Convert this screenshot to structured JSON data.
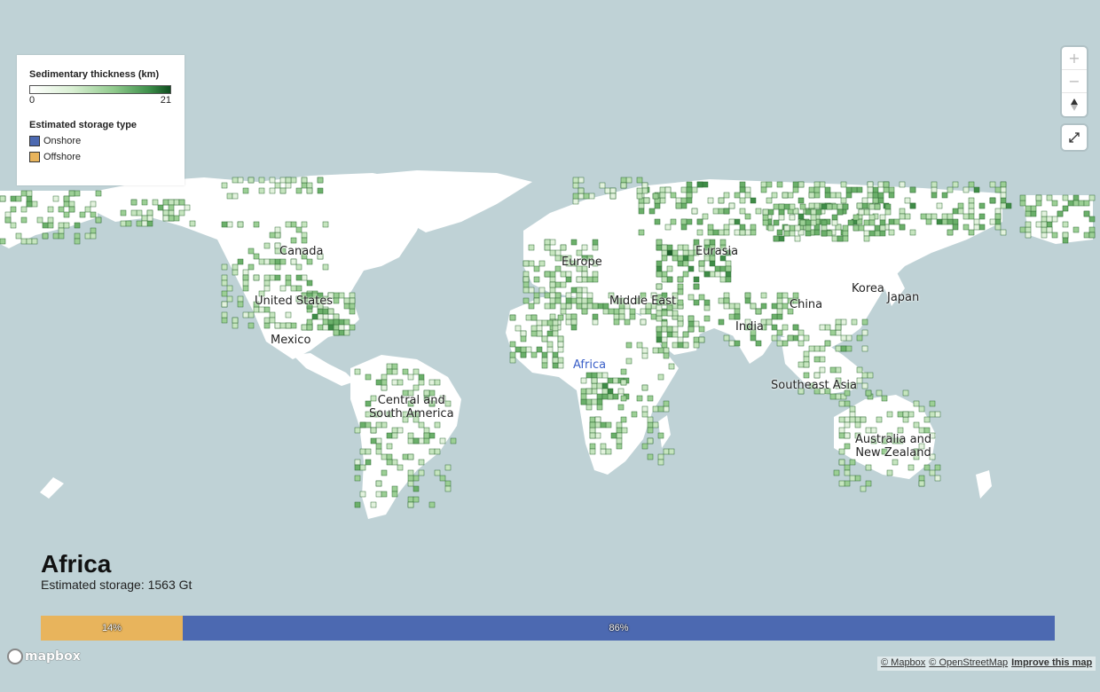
{
  "legend": {
    "thickness_title": "Sedimentary thickness (km)",
    "thickness_min": "0",
    "thickness_max": "21",
    "storage_title": "Estimated storage type",
    "onshore_label": "Onshore",
    "offshore_label": "Offshore",
    "onshore_color": "#4c69b1",
    "offshore_color": "#e8b45c"
  },
  "labels": {
    "canada": "Canada",
    "united_states": "United States",
    "mexico": "Mexico",
    "central_south_america_1": "Central and",
    "central_south_america_2": "South America",
    "europe": "Europe",
    "eurasia": "Eurasia",
    "middle_east": "Middle East",
    "africa": "Africa",
    "india": "India",
    "china": "China",
    "korea": "Korea",
    "japan": "Japan",
    "southeast_asia": "Southeast Asia",
    "australia_nz_1": "Australia and",
    "australia_nz_2": "New Zealand"
  },
  "selected_region": "Africa",
  "panel": {
    "title": "Africa",
    "storage_text": "Estimated storage: 1563 Gt",
    "offshore_pct": 14,
    "onshore_pct": 86,
    "offshore_label": "14%",
    "onshore_label": "86%"
  },
  "controls": {
    "zoom_in_icon": "plus-icon",
    "zoom_out_icon": "minus-icon",
    "compass_icon": "compass-icon",
    "fullscreen_icon": "expand-icon"
  },
  "footer": {
    "logo_text": "mapbox",
    "attrib_mapbox": "© Mapbox",
    "attrib_osm": "© OpenStreetMap",
    "attrib_improve": "Improve this map"
  }
}
